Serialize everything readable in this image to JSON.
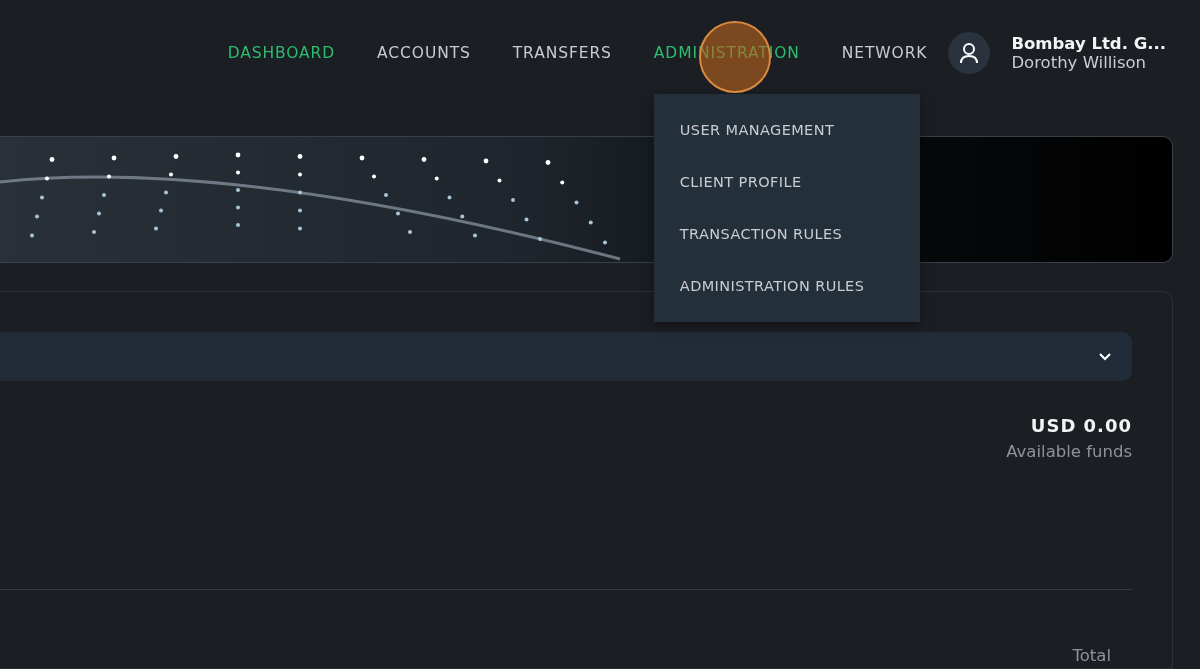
{
  "nav": [
    {
      "label": "DASHBOARD",
      "active": true
    },
    {
      "label": "ACCOUNTS",
      "active": false
    },
    {
      "label": "TRANSFERS",
      "active": false
    },
    {
      "label": "ADMINISTRATION",
      "active": true,
      "expanded": true,
      "menu": [
        "USER MANAGEMENT",
        "CLIENT PROFILE",
        "TRANSACTION RULES",
        "ADMINISTRATION RULES"
      ]
    },
    {
      "label": "NETWORK",
      "active": false
    }
  ],
  "user": {
    "company": "Bombay Ltd. G...",
    "name": "Dorothy Willison"
  },
  "balance": {
    "amount": "USD 0.00",
    "label": "Available funds"
  },
  "table": {
    "columns": [
      "Total"
    ]
  }
}
